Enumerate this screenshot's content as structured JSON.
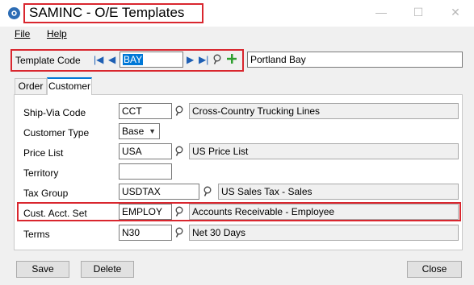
{
  "window": {
    "title": "SAMINC - O/E Templates",
    "minimize_glyph": "—",
    "maximize_glyph": "☐",
    "close_glyph": "✕"
  },
  "menu": {
    "file_label": "File",
    "help_label": "Help"
  },
  "template": {
    "label": "Template Code",
    "value": "BAY",
    "description": "Portland Bay"
  },
  "tabs": [
    {
      "label": "Order"
    },
    {
      "label": "Customer"
    }
  ],
  "customer": {
    "ship_via": {
      "label": "Ship-Via Code",
      "value": "CCT",
      "description": "Cross-Country Trucking Lines"
    },
    "customer_type": {
      "label": "Customer Type",
      "value": "Base"
    },
    "price_list": {
      "label": "Price List",
      "value": "USA",
      "description": "US Price List"
    },
    "territory": {
      "label": "Territory",
      "value": ""
    },
    "tax_group": {
      "label": "Tax Group",
      "value": "USDTAX",
      "description": "US Sales Tax - Sales"
    },
    "cust_acct_set": {
      "label": "Cust. Acct. Set",
      "value": "EMPLOY",
      "description": "Accounts Receivable - Employee"
    },
    "terms": {
      "label": "Terms",
      "value": "N30",
      "description": "Net 30 Days"
    }
  },
  "buttons": {
    "save": "Save",
    "delete": "Delete",
    "close": "Close"
  },
  "colors": {
    "highlight": "#d9262e",
    "accent": "#0078d7",
    "nav_arrows": "#1e5fb4",
    "add_icon": "#2e9e2e"
  },
  "icons": [
    "app-gear-icon",
    "first-record-icon",
    "previous-record-icon",
    "next-record-icon",
    "last-record-icon",
    "search-icon",
    "add-icon",
    "chevron-down-icon"
  ]
}
